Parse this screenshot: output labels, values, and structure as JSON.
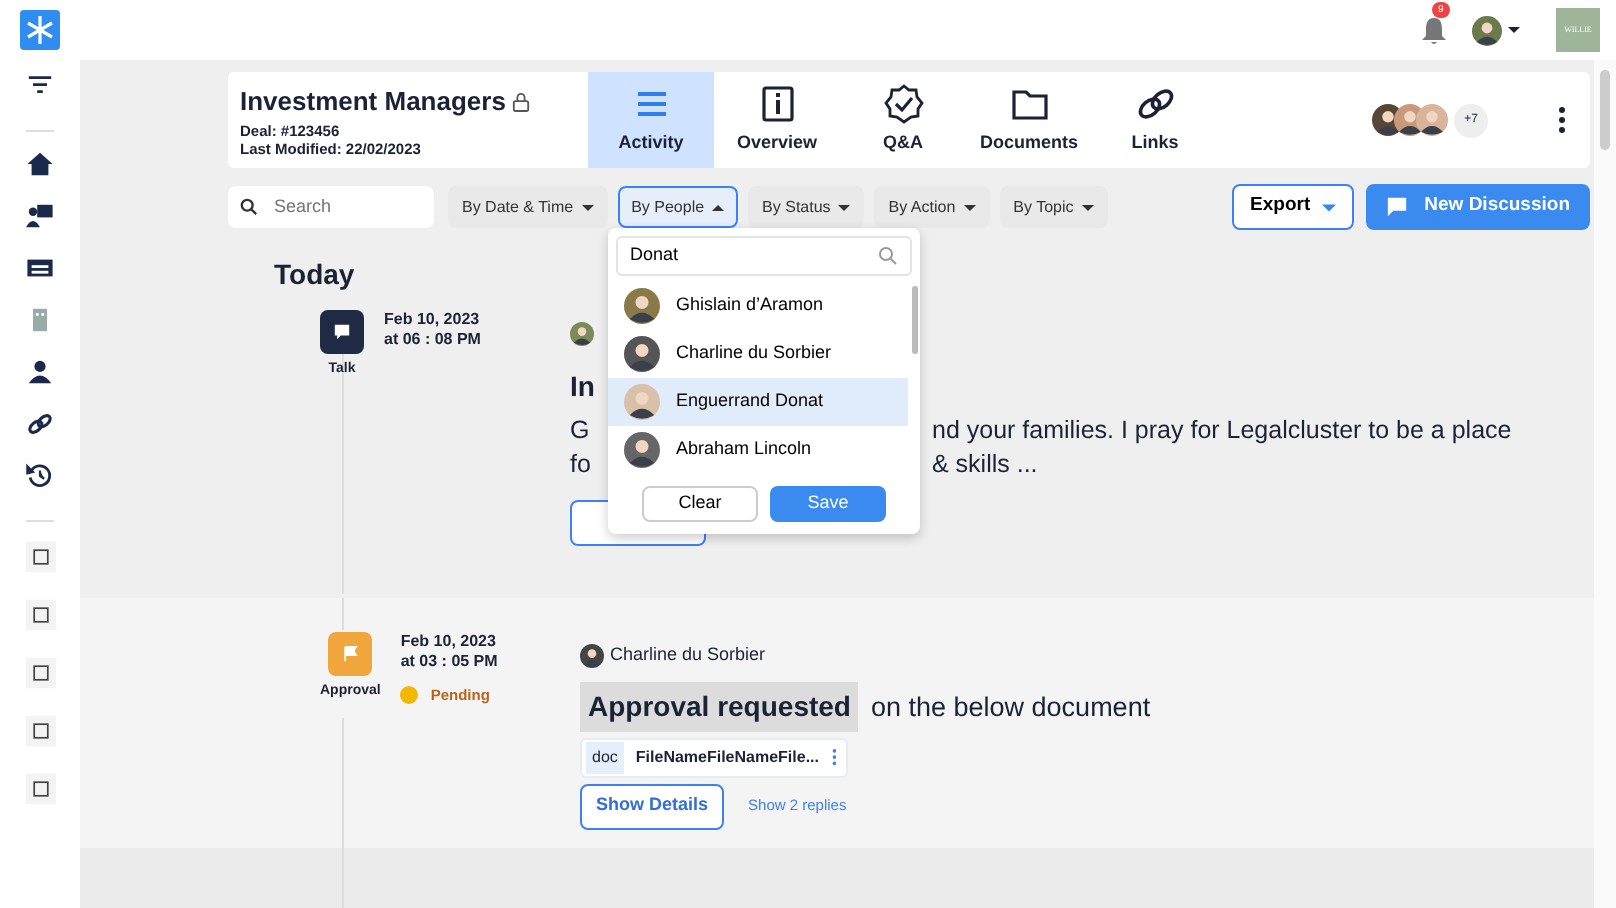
{
  "topbar": {
    "notification_count": "9",
    "brand": "WILLIE"
  },
  "deal": {
    "title": "Investment Managers",
    "locked": true,
    "deal_no": "Deal: #123456",
    "modified": "Last Modified: 22/02/2023"
  },
  "tabs": [
    {
      "label": "Activity",
      "selected": true
    },
    {
      "label": "Overview",
      "selected": false
    },
    {
      "label": "Q&A",
      "selected": false
    },
    {
      "label": "Documents",
      "selected": false
    },
    {
      "label": "Links",
      "selected": false
    }
  ],
  "participants": {
    "more": "+7"
  },
  "search": {
    "placeholder": "Search"
  },
  "filters": [
    {
      "label": "By Date & Time",
      "open": false
    },
    {
      "label": "By People",
      "open": true
    },
    {
      "label": "By Status",
      "open": false
    },
    {
      "label": "By Action",
      "open": false
    },
    {
      "label": "By Topic",
      "open": false
    }
  ],
  "export_button": "Export",
  "new_discussion_button": "New Discussion",
  "people_dropdown": {
    "query": "Donat",
    "people": [
      {
        "name": "Ghislain d’Aramon",
        "selected": false
      },
      {
        "name": "Charline du Sorbier",
        "selected": false
      },
      {
        "name": "Enguerrand Donat",
        "selected": true
      },
      {
        "name": "Abraham Lincoln",
        "selected": false
      }
    ],
    "clear": "Clear",
    "save": "Save"
  },
  "timeline": {
    "heading": "Today",
    "events": [
      {
        "kind": "talk",
        "type_label": "Talk",
        "date": "Feb 10, 2023",
        "time": "at 06 : 08 PM",
        "title": "In",
        "lines": [
          {
            "left": "G",
            "right": "nd your families. I pray for Legalcluster to be a place"
          },
          {
            "left": "fo",
            "right": "& skills ..."
          }
        ]
      },
      {
        "kind": "approval",
        "type_label": "Approval",
        "date": "Feb 10, 2023",
        "time": "at 03 : 05 PM",
        "status": "Pending",
        "author": "Charline du Sorbier",
        "highlight": "Approval requested",
        "text": "on the below document",
        "file": {
          "type": "doc",
          "name": "FileNameFileNameFile..."
        },
        "details_button": "Show Details",
        "replies_link": "Show 2 replies"
      }
    ]
  }
}
